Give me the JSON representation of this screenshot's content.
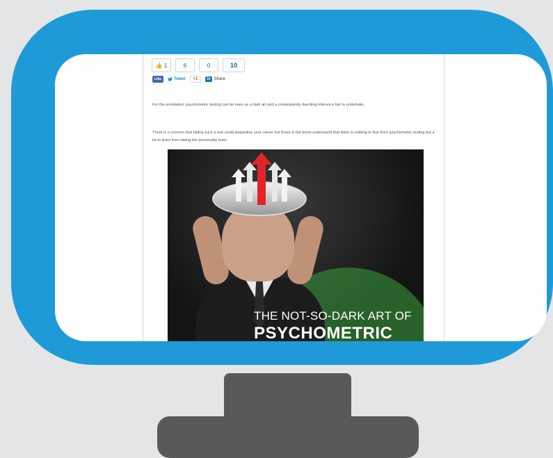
{
  "share_counts": {
    "like": "👍 1",
    "twitter": "6",
    "gplus": "0",
    "total": "10"
  },
  "social_buttons": {
    "facebook": "Like",
    "twitter": "Tweet",
    "gplus": "+1",
    "linkedin_icon": "in",
    "linkedin": "Share"
  },
  "article": {
    "paragraph1": "For the uninitiated, psychometric testing can be seen as a dark art and a consequently daunting inference bar to undertake.",
    "paragraph2": "There is a concern that failing such a test could jeopardise your career but those in the know understand that there is nothing to fear from psychometric testing but a lot to learn from taking the personality tests."
  },
  "image": {
    "title_line1": "THE NOT-SO-DARK ART OF",
    "title_line2": "PSYCHOMETRIC"
  },
  "colors": {
    "bezel": "#1f9ad8",
    "stand": "#58595b",
    "background": "#e4e5e6",
    "arrow_red": "#e0262a",
    "green_overlay": "#3aa03c"
  }
}
